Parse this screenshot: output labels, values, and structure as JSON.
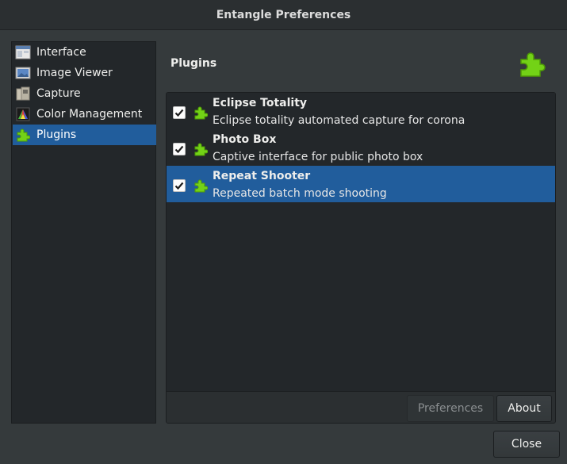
{
  "window": {
    "title": "Entangle Preferences"
  },
  "sidebar": {
    "items": [
      {
        "label": "Interface",
        "icon": "interface-icon"
      },
      {
        "label": "Image Viewer",
        "icon": "image-viewer-icon"
      },
      {
        "label": "Capture",
        "icon": "capture-icon"
      },
      {
        "label": "Color Management",
        "icon": "color-management-icon"
      },
      {
        "label": "Plugins",
        "icon": "plugin-icon",
        "selected": true
      }
    ]
  },
  "panel": {
    "title": "Plugins",
    "icon": "plugin-icon"
  },
  "plugins": [
    {
      "name": "Eclipse Totality",
      "description": "Eclipse totality automated capture for corona",
      "enabled": true
    },
    {
      "name": "Photo Box",
      "description": "Captive interface for public photo box",
      "enabled": true
    },
    {
      "name": "Repeat Shooter",
      "description": "Repeated batch mode shooting",
      "enabled": true,
      "selected": true
    }
  ],
  "actions": {
    "preferences_label": "Preferences",
    "about_label": "About",
    "close_label": "Close"
  },
  "colors": {
    "accent": "#215d9c",
    "plugin_green": "#73d216"
  }
}
